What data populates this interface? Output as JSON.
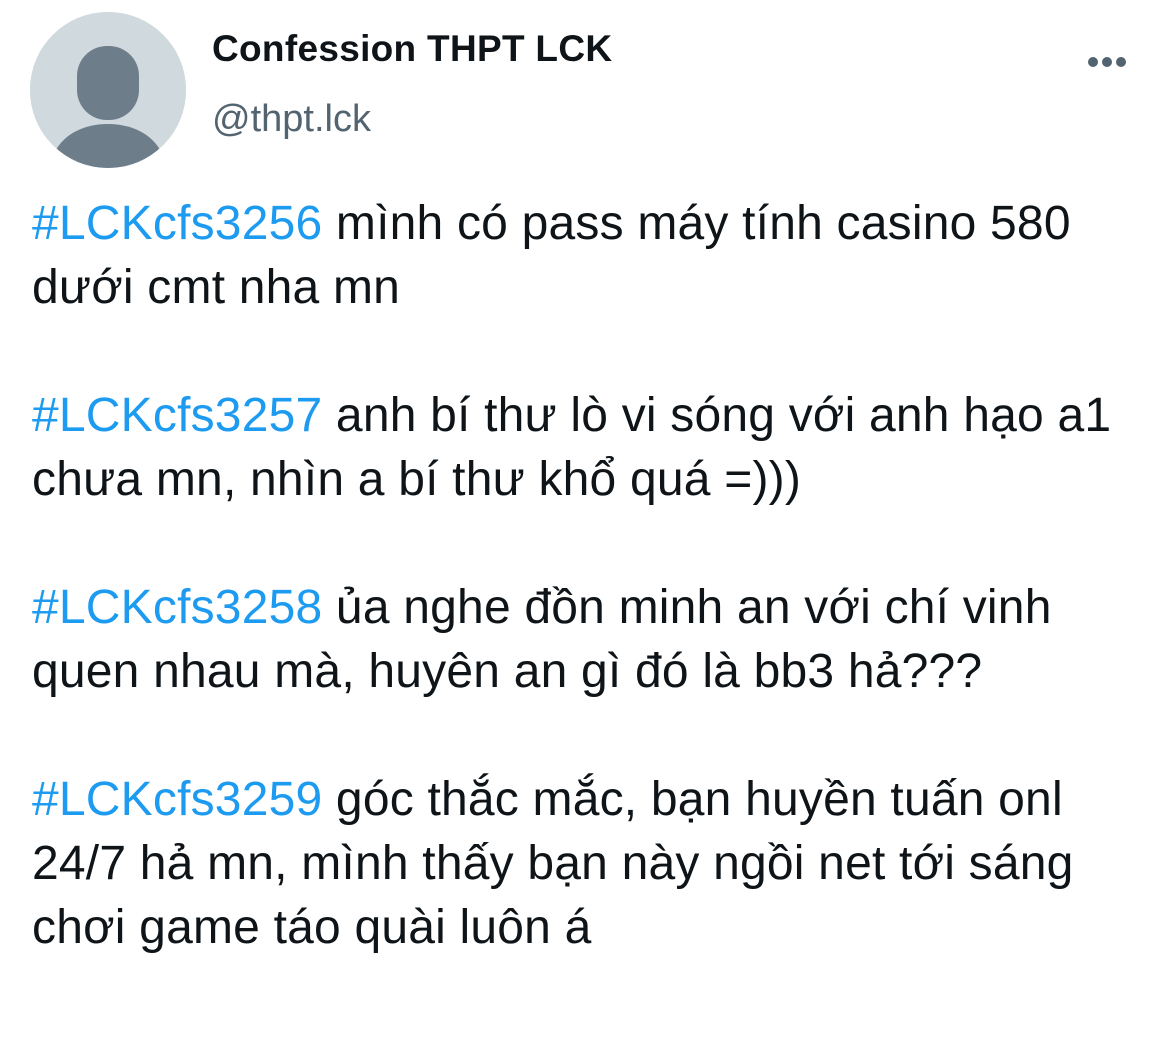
{
  "tweet": {
    "author": {
      "display_name": "Confession THPT LCK",
      "handle": "@thpt.lck",
      "avatar_icon": "default-avatar-icon"
    },
    "more_icon": "more-options-icon",
    "paragraphs": [
      {
        "hashtag": "#LCKcfs3256",
        "text": " mình có pass máy tính casino 580 dưới cmt nha mn"
      },
      {
        "hashtag": "#LCKcfs3257",
        "text": " anh bí thư lò vi sóng với anh hạo a1 chưa mn, nhìn a bí thư khổ quá =)))"
      },
      {
        "hashtag": "#LCKcfs3258",
        "text": " ủa nghe đồn minh an với chí vinh quen nhau mà, huyên an gì đó là bb3 hả???"
      },
      {
        "hashtag": "#LCKcfs3259",
        "text": " góc thắc mắc, bạn huyền tuấn onl 24/7 hả mn, mình thấy bạn này ngồi net tới sáng chơi game táo quài luôn á"
      }
    ]
  },
  "colors": {
    "hashtag": "#1d9bf0",
    "text": "#0f1419",
    "secondary": "#536471",
    "avatar_bg": "#cfd9de",
    "avatar_fg": "#6e7d8a"
  }
}
